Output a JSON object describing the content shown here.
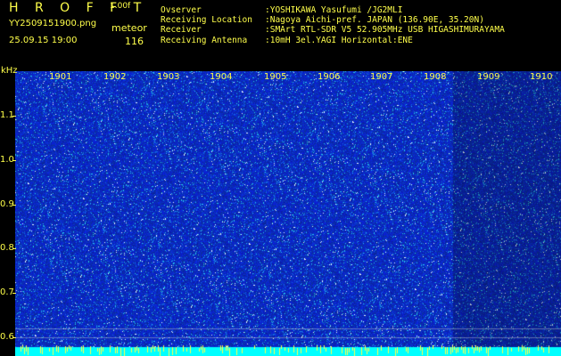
{
  "header": {
    "brand": "H R O F F T",
    "version": "1.00f",
    "filename": "YY2509151900.png",
    "mode": "meteor",
    "datetime": "25.09.15 19:00",
    "count": "116"
  },
  "info": [
    {
      "label": "Ovserver",
      "value": ":YOSHIKAWA Yasufumi /JG2MLI"
    },
    {
      "label": "Receiving Location",
      "value": ":Nagoya Aichi-pref. JAPAN (136.90E, 35.20N)"
    },
    {
      "label": "Receiver",
      "value": ":SMArt RTL-SDR V5 52.905MHz USB HIGASHIMURAYAMA"
    },
    {
      "label": "Receiving Antenna",
      "value": ":10mH 3el.YAGI Horizontal:ENE"
    }
  ],
  "axis": {
    "unit": "kHz",
    "y_ticks": [
      "1.1",
      "1.0",
      "0.9",
      "0.8",
      "0.7",
      "0.6"
    ],
    "x_ticks": [
      "1901",
      "1902",
      "1903",
      "1904",
      "1905",
      "1906",
      "1907",
      "1908",
      "1909",
      "1910"
    ]
  },
  "colors": {
    "text": "#ffff4a",
    "background": "#000000",
    "spectrum_base": "#1a2bd0",
    "signal_strip": "#00ffff"
  }
}
